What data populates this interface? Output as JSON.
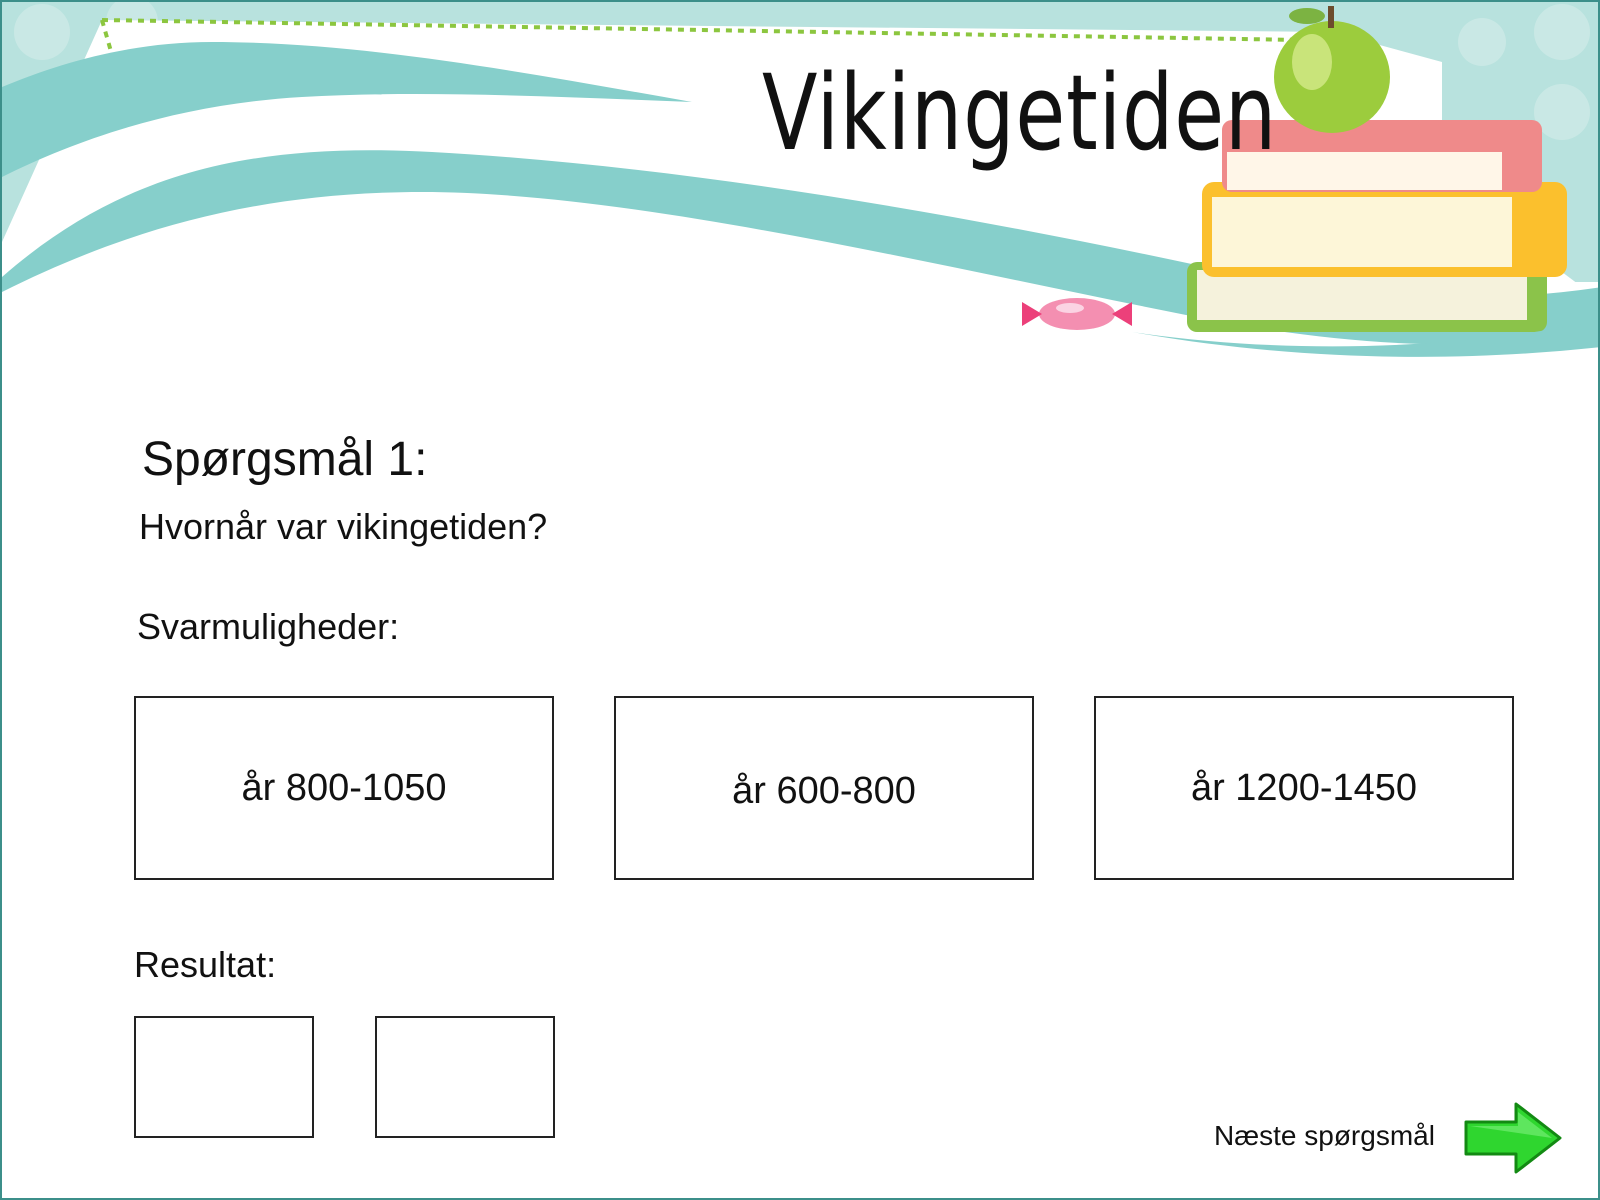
{
  "header": {
    "title": "Vikingetiden"
  },
  "question": {
    "heading": "Spørgsmål 1:",
    "text": "Hvornår var vikingetiden?"
  },
  "options": {
    "label": "Svarmuligheder:",
    "items": [
      {
        "label": "år 800-1050"
      },
      {
        "label": "år 600-800"
      },
      {
        "label": "år 1200-1450"
      }
    ]
  },
  "result": {
    "label": "Resultat:"
  },
  "navigation": {
    "next_label": "Næste spørgsmål"
  },
  "colors": {
    "teal_wave": "#86cfcb",
    "border": "#3c8f8a",
    "arrow_green": "#2fd62f"
  }
}
